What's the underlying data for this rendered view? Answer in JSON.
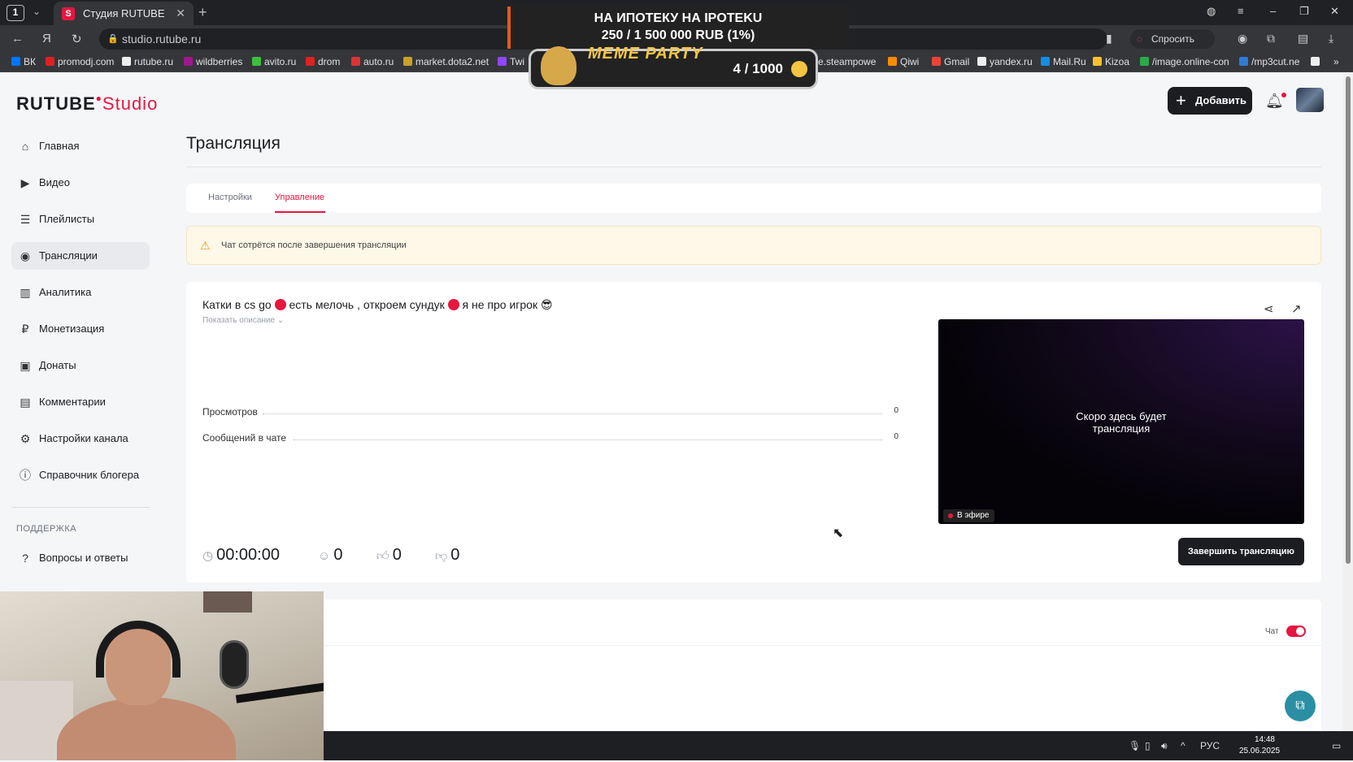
{
  "browser": {
    "tab_counter": "1",
    "tab_title": "Студия RUTUBE",
    "tab_favicon": "S",
    "url": "studio.rutube.ru",
    "ask_label": "Спросить",
    "bookmarks": [
      "ВК",
      "promodj.com",
      "rutube.ru",
      "wildberries",
      "avito.ru",
      "drom",
      "auto.ru",
      "market.dota2.net",
      "Twi",
      "e.steampowe",
      "Qiwi",
      "Gmail",
      "yandex.ru",
      "Mail.Ru",
      "Kizoa",
      "/image.online-con",
      "/mp3cut.ne"
    ]
  },
  "overlay": {
    "goal_line1": "НА ИПОТЕКУ НА IPOTEKU",
    "goal_line2": "250 / 1 500 000 RUB (1%)",
    "meme_title": "MEME PARTY",
    "meme_count": "4 / 1000"
  },
  "header": {
    "logo_rutube": "RUTUBE",
    "logo_studio": "Studio",
    "add_label": "Добавить"
  },
  "sidebar": {
    "items": [
      {
        "label": "Главная",
        "icon": "home-icon"
      },
      {
        "label": "Видео",
        "icon": "video-icon"
      },
      {
        "label": "Плейлисты",
        "icon": "playlist-icon"
      },
      {
        "label": "Трансляции",
        "icon": "broadcast-icon"
      },
      {
        "label": "Аналитика",
        "icon": "analytics-icon"
      },
      {
        "label": "Монетизация",
        "icon": "ruble-icon"
      },
      {
        "label": "Донаты",
        "icon": "donate-icon"
      },
      {
        "label": "Комментарии",
        "icon": "comments-icon"
      },
      {
        "label": "Настройки канала",
        "icon": "gear-icon"
      },
      {
        "label": "Справочник блогера",
        "icon": "info-icon"
      }
    ],
    "support_section": "ПОДДЕРЖКА",
    "faq_label": "Вопросы и ответы"
  },
  "page": {
    "title": "Трансляция",
    "tabs": [
      "Настройки",
      "Управление"
    ],
    "warning": "Чат сотрётся после завершения трансляции"
  },
  "stream": {
    "title_part1": "Катки в cs go",
    "title_part2": "есть мелочь , откроем сундук",
    "title_part3": "я не про игрок 😎",
    "show_description": "Показать описание",
    "stats": [
      {
        "label": "Просмотров",
        "value": "0"
      },
      {
        "label": "Сообщений в чате",
        "value": "0"
      }
    ],
    "duration": "00:00:00",
    "viewers": "0",
    "likes": "0",
    "dislikes": "0",
    "player_soon_line1": "Скоро здесь будет",
    "player_soon_line2": "трансляция",
    "live_badge": "В эфире",
    "end_button": "Завершить трансляцию"
  },
  "chat": {
    "toggle_label": "Чат",
    "toggle_on": true
  },
  "taskbar": {
    "lang": "РУС",
    "time": "14:48",
    "date": "25.06.2025"
  },
  "colors": {
    "accent": "#e5173f",
    "dark": "#1b1d21",
    "warning_bg": "#fdf8e7"
  }
}
